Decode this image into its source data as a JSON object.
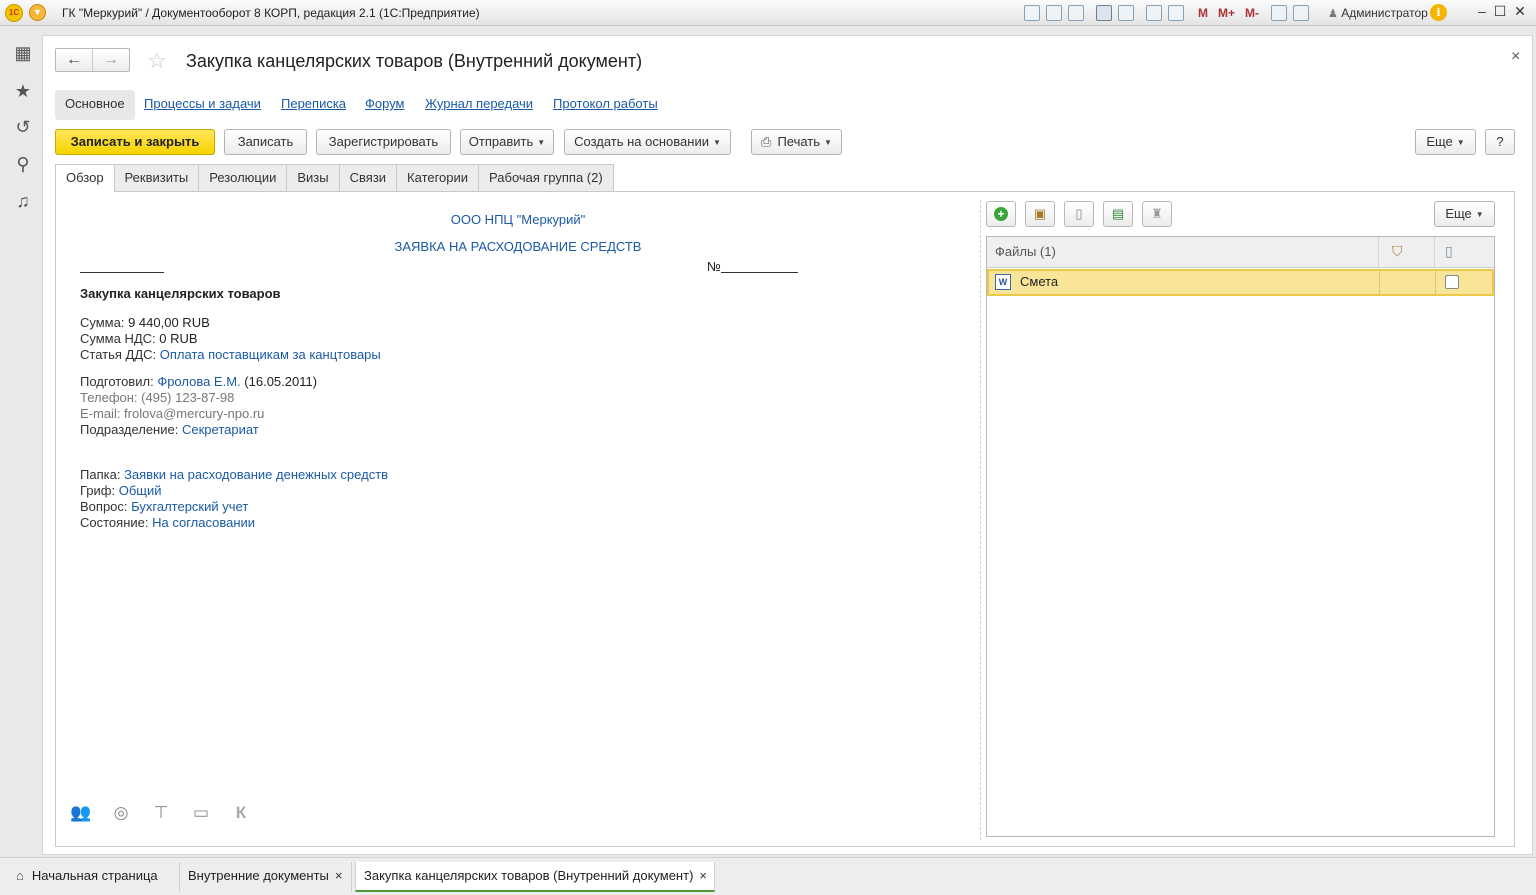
{
  "titlebar": {
    "app_title": "ГК \"Меркурий\" / Документооборот 8 КОРП, редакция 2.1  (1С:Предприятие)",
    "memory_buttons": [
      "M",
      "M+",
      "M-"
    ],
    "user": "Администратор"
  },
  "form": {
    "title": "Закупка канцелярских товаров (Внутренний документ)",
    "sections": [
      "Основное",
      "Процессы и задачи",
      "Переписка",
      "Форум",
      "Журнал передачи",
      "Протокол работы"
    ],
    "toolbar": {
      "save_close": "Записать и закрыть",
      "save": "Записать",
      "register": "Зарегистрировать",
      "send": "Отправить",
      "create_based": "Создать на основании",
      "print": "Печать",
      "more": "Еще",
      "help": "?"
    },
    "tabs": [
      "Обзор",
      "Реквизиты",
      "Резолюции",
      "Визы",
      "Связи",
      "Категории",
      "Рабочая группа (2)"
    ]
  },
  "overview": {
    "org": "ООО НПЦ \"Меркурий\"",
    "doc_kind": "ЗАЯВКА НА РАСХОДОВАНИЕ СРЕДСТВ",
    "number_label": "№",
    "subject": "Закупка канцелярских товаров",
    "sum_label": "Сумма:",
    "sum_value": "9 440,00 RUB",
    "vat_label": "Сумма НДС:",
    "vat_value": "0 RUB",
    "dds_label": "Статья ДДС:",
    "dds_value": "Оплата поставщикам за канцтовары",
    "prepared_label": "Подготовил:",
    "prepared_value": "Фролова Е.М.",
    "prepared_date": "(16.05.2011)",
    "phone": "Телефон: (495) 123-87-98",
    "email": "E-mail: frolova@mercury-npo.ru",
    "dept_label": "Подразделение:",
    "dept_value": "Секретариат",
    "folder_label": "Папка:",
    "folder_value": "Заявки на расходование денежных средств",
    "grif_label": "Гриф:",
    "grif_value": "Общий",
    "question_label": "Вопрос:",
    "question_value": "Бухгалтерский учет",
    "state_label": "Состояние:",
    "state_value": "На согласовании",
    "k_letter": "К"
  },
  "files": {
    "more": "Еще",
    "header": "Файлы (1)",
    "rows": [
      {
        "name": "Смета",
        "icon": "word-icon",
        "checked": false
      }
    ]
  },
  "taskbar": {
    "home": "Начальная страница",
    "tab1": "Внутренние документы",
    "tab2": "Закупка канцелярских товаров (Внутренний документ)",
    "close_glyph": "×"
  }
}
